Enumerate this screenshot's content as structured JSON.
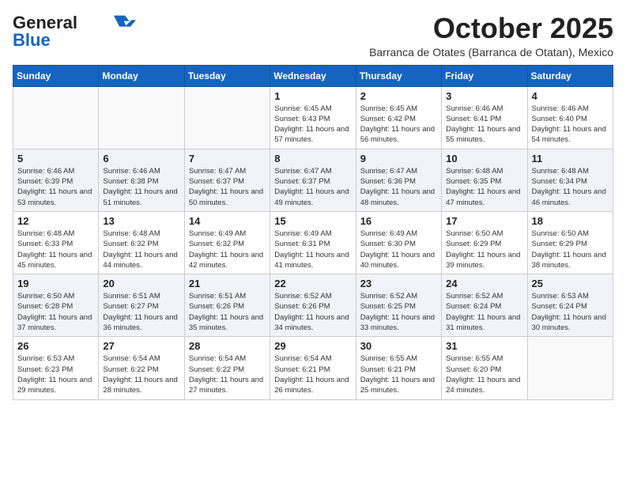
{
  "header": {
    "logo_line1": "General",
    "logo_line2": "Blue",
    "month": "October 2025",
    "location": "Barranca de Otates (Barranca de Otatan), Mexico"
  },
  "days_of_week": [
    "Sunday",
    "Monday",
    "Tuesday",
    "Wednesday",
    "Thursday",
    "Friday",
    "Saturday"
  ],
  "weeks": [
    [
      {
        "day": "",
        "info": ""
      },
      {
        "day": "",
        "info": ""
      },
      {
        "day": "",
        "info": ""
      },
      {
        "day": "1",
        "info": "Sunrise: 6:45 AM\nSunset: 6:43 PM\nDaylight: 11 hours and 57 minutes."
      },
      {
        "day": "2",
        "info": "Sunrise: 6:45 AM\nSunset: 6:42 PM\nDaylight: 11 hours and 56 minutes."
      },
      {
        "day": "3",
        "info": "Sunrise: 6:46 AM\nSunset: 6:41 PM\nDaylight: 11 hours and 55 minutes."
      },
      {
        "day": "4",
        "info": "Sunrise: 6:46 AM\nSunset: 6:40 PM\nDaylight: 11 hours and 54 minutes."
      }
    ],
    [
      {
        "day": "5",
        "info": "Sunrise: 6:46 AM\nSunset: 6:39 PM\nDaylight: 11 hours and 53 minutes."
      },
      {
        "day": "6",
        "info": "Sunrise: 6:46 AM\nSunset: 6:38 PM\nDaylight: 11 hours and 51 minutes."
      },
      {
        "day": "7",
        "info": "Sunrise: 6:47 AM\nSunset: 6:37 PM\nDaylight: 11 hours and 50 minutes."
      },
      {
        "day": "8",
        "info": "Sunrise: 6:47 AM\nSunset: 6:37 PM\nDaylight: 11 hours and 49 minutes."
      },
      {
        "day": "9",
        "info": "Sunrise: 6:47 AM\nSunset: 6:36 PM\nDaylight: 11 hours and 48 minutes."
      },
      {
        "day": "10",
        "info": "Sunrise: 6:48 AM\nSunset: 6:35 PM\nDaylight: 11 hours and 47 minutes."
      },
      {
        "day": "11",
        "info": "Sunrise: 6:48 AM\nSunset: 6:34 PM\nDaylight: 11 hours and 46 minutes."
      }
    ],
    [
      {
        "day": "12",
        "info": "Sunrise: 6:48 AM\nSunset: 6:33 PM\nDaylight: 11 hours and 45 minutes."
      },
      {
        "day": "13",
        "info": "Sunrise: 6:48 AM\nSunset: 6:32 PM\nDaylight: 11 hours and 44 minutes."
      },
      {
        "day": "14",
        "info": "Sunrise: 6:49 AM\nSunset: 6:32 PM\nDaylight: 11 hours and 42 minutes."
      },
      {
        "day": "15",
        "info": "Sunrise: 6:49 AM\nSunset: 6:31 PM\nDaylight: 11 hours and 41 minutes."
      },
      {
        "day": "16",
        "info": "Sunrise: 6:49 AM\nSunset: 6:30 PM\nDaylight: 11 hours and 40 minutes."
      },
      {
        "day": "17",
        "info": "Sunrise: 6:50 AM\nSunset: 6:29 PM\nDaylight: 11 hours and 39 minutes."
      },
      {
        "day": "18",
        "info": "Sunrise: 6:50 AM\nSunset: 6:29 PM\nDaylight: 11 hours and 38 minutes."
      }
    ],
    [
      {
        "day": "19",
        "info": "Sunrise: 6:50 AM\nSunset: 6:28 PM\nDaylight: 11 hours and 37 minutes."
      },
      {
        "day": "20",
        "info": "Sunrise: 6:51 AM\nSunset: 6:27 PM\nDaylight: 11 hours and 36 minutes."
      },
      {
        "day": "21",
        "info": "Sunrise: 6:51 AM\nSunset: 6:26 PM\nDaylight: 11 hours and 35 minutes."
      },
      {
        "day": "22",
        "info": "Sunrise: 6:52 AM\nSunset: 6:26 PM\nDaylight: 11 hours and 34 minutes."
      },
      {
        "day": "23",
        "info": "Sunrise: 6:52 AM\nSunset: 6:25 PM\nDaylight: 11 hours and 33 minutes."
      },
      {
        "day": "24",
        "info": "Sunrise: 6:52 AM\nSunset: 6:24 PM\nDaylight: 11 hours and 31 minutes."
      },
      {
        "day": "25",
        "info": "Sunrise: 6:53 AM\nSunset: 6:24 PM\nDaylight: 11 hours and 30 minutes."
      }
    ],
    [
      {
        "day": "26",
        "info": "Sunrise: 6:53 AM\nSunset: 6:23 PM\nDaylight: 11 hours and 29 minutes."
      },
      {
        "day": "27",
        "info": "Sunrise: 6:54 AM\nSunset: 6:22 PM\nDaylight: 11 hours and 28 minutes."
      },
      {
        "day": "28",
        "info": "Sunrise: 6:54 AM\nSunset: 6:22 PM\nDaylight: 11 hours and 27 minutes."
      },
      {
        "day": "29",
        "info": "Sunrise: 6:54 AM\nSunset: 6:21 PM\nDaylight: 11 hours and 26 minutes."
      },
      {
        "day": "30",
        "info": "Sunrise: 6:55 AM\nSunset: 6:21 PM\nDaylight: 11 hours and 25 minutes."
      },
      {
        "day": "31",
        "info": "Sunrise: 6:55 AM\nSunset: 6:20 PM\nDaylight: 11 hours and 24 minutes."
      },
      {
        "day": "",
        "info": ""
      }
    ]
  ],
  "shaded_rows": [
    1,
    3
  ]
}
